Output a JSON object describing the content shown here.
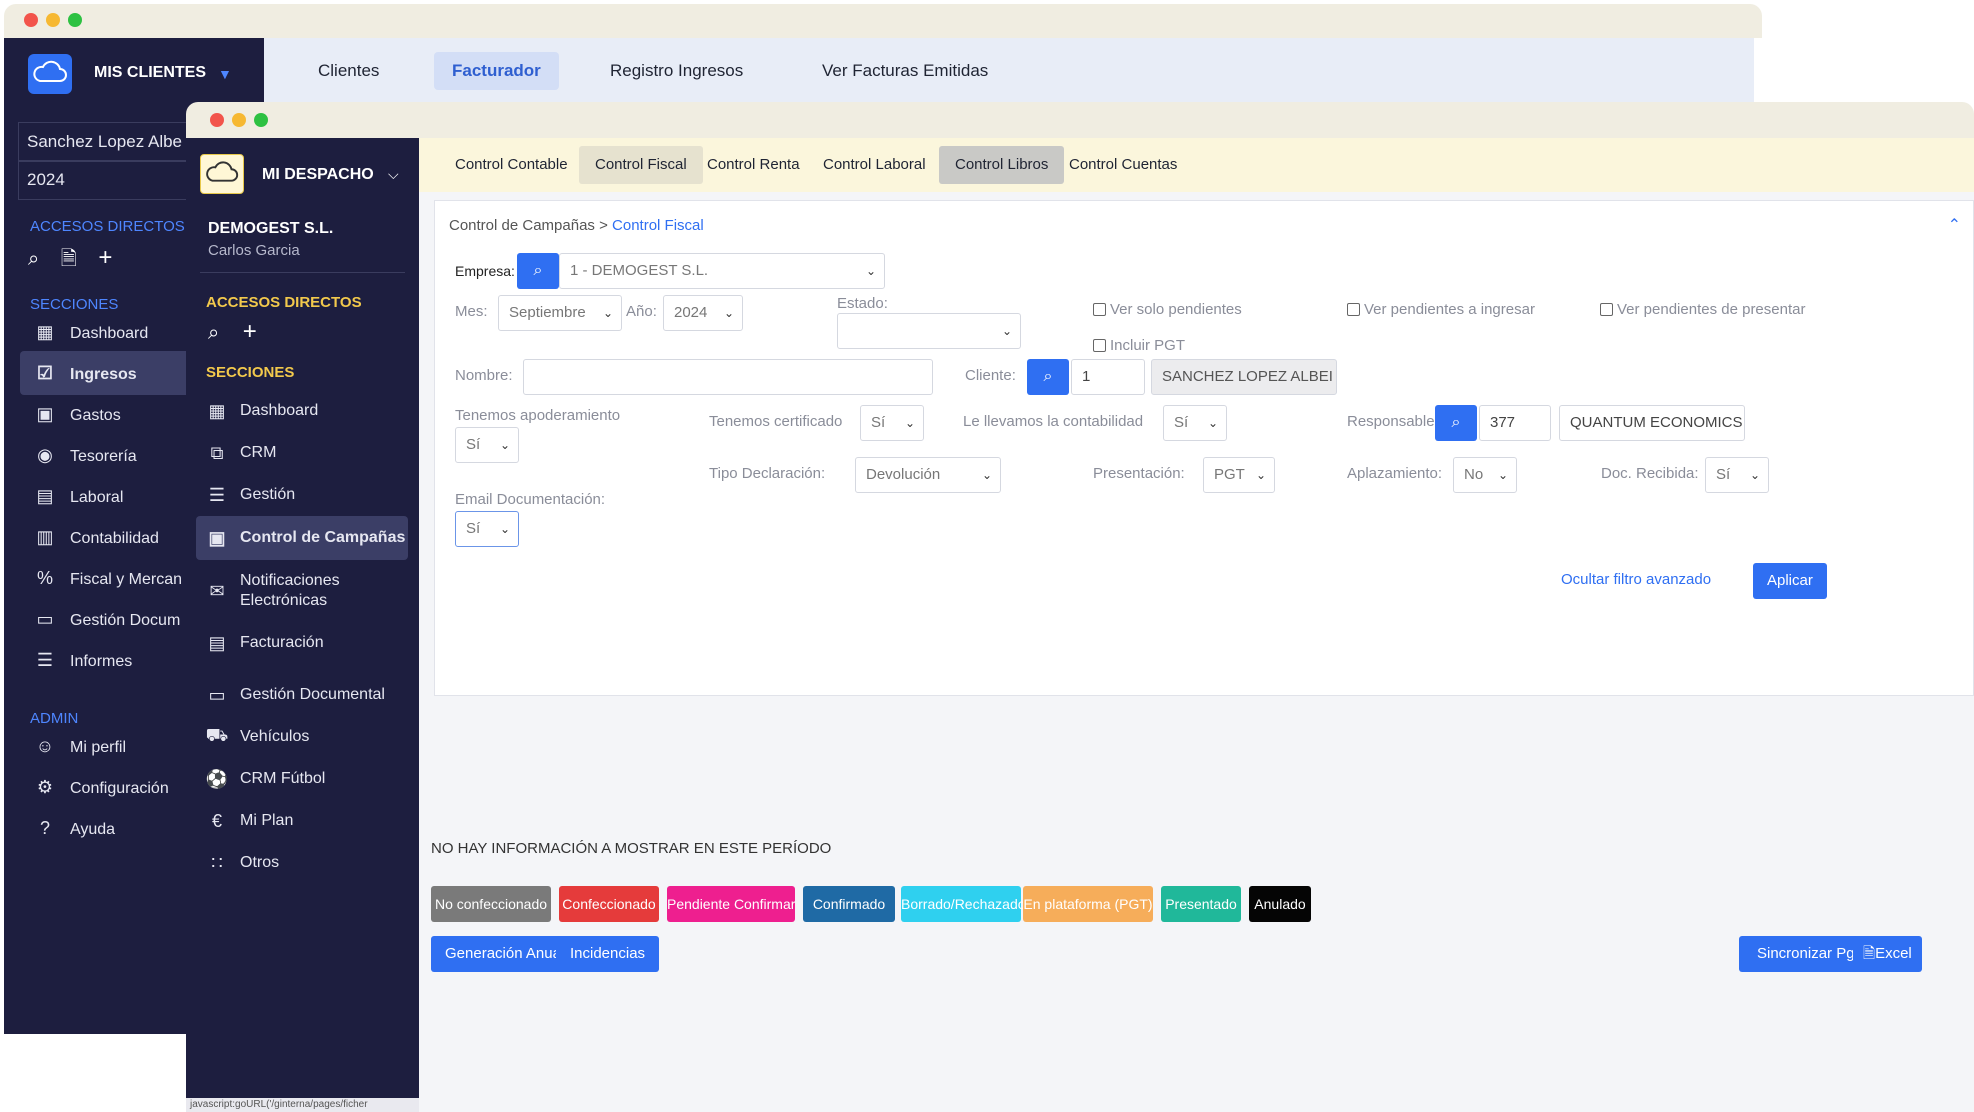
{
  "back_window": {
    "brand": "MIS CLIENTES",
    "client_field": "Sanchez Lopez Albe",
    "year_field": "2024",
    "quick_access_label": "ACCESOS DIRECTOS",
    "sections_label": "SECCIONES",
    "admin_label": "ADMIN",
    "nav": [
      "Clientes",
      "Facturador",
      "Registro Ingresos",
      "Ver Facturas Emitidas"
    ],
    "active_nav": "Facturador",
    "sidebar_items": [
      {
        "label": "Dashboard",
        "icon": "dashboard-icon"
      },
      {
        "label": "Ingresos",
        "icon": "ingresos-icon"
      },
      {
        "label": "Gastos",
        "icon": "gastos-icon"
      },
      {
        "label": "Tesorería",
        "icon": "tesoreria-icon"
      },
      {
        "label": "Laboral",
        "icon": "laboral-icon"
      },
      {
        "label": "Contabilidad",
        "icon": "contabilidad-icon"
      },
      {
        "label": "Fiscal y Mercan",
        "icon": "percent-icon"
      },
      {
        "label": "Gestión Docum",
        "icon": "folder-icon"
      },
      {
        "label": "Informes",
        "icon": "informes-icon"
      }
    ],
    "admin_items": [
      {
        "label": "Mi perfil",
        "icon": "user-icon"
      },
      {
        "label": "Configuración",
        "icon": "gear-icon"
      },
      {
        "label": "Ayuda",
        "icon": "help-icon"
      }
    ]
  },
  "front_window": {
    "brand": "MI DESPACHO",
    "company": "DEMOGEST S.L.",
    "user": "Carlos Garcia",
    "quick_access_label": "ACCESOS DIRECTOS",
    "sections_label": "SECCIONES",
    "sidebar_items": [
      {
        "label": "Dashboard",
        "icon": "dashboard-icon"
      },
      {
        "label": "CRM",
        "icon": "crm-icon"
      },
      {
        "label": "Gestión",
        "icon": "gestion-icon"
      },
      {
        "label": "Control de Campañas",
        "icon": "campaigns-icon"
      },
      {
        "label": "Notificaciones Electrónicas",
        "icon": "notifications-icon"
      },
      {
        "label": "Facturación",
        "icon": "invoice-icon"
      },
      {
        "label": "Gestión Documental",
        "icon": "folder-icon"
      },
      {
        "label": "Vehículos",
        "icon": "car-icon"
      },
      {
        "label": "CRM Fútbol",
        "icon": "football-icon"
      },
      {
        "label": "Mi Plan",
        "icon": "euro-icon"
      },
      {
        "label": "Otros",
        "icon": "grid-icon"
      }
    ],
    "status_bar": "javascript:goURL('/ginterna/pages/ficher",
    "tabs": [
      "Control Contable",
      "Control Fiscal",
      "Control Renta",
      "Control Laboral",
      "Control Libros",
      "Control Cuentas"
    ],
    "breadcrumb": {
      "parent": "Control de Campañas",
      "sep": ">",
      "current": "Control Fiscal"
    },
    "filters": {
      "empresa_label": "Empresa:",
      "empresa_value": "1 - DEMOGEST S.L.",
      "mes_label": "Mes:",
      "mes_value": "Septiembre",
      "anio_label": "Año:",
      "anio_value": "2024",
      "estado_label": "Estado:",
      "estado_value": "",
      "ver_solo_pendientes": "Ver solo pendientes",
      "incluir_pgt": "Incluir PGT",
      "ver_pendientes_ingresar": "Ver pendientes a ingresar",
      "ver_pendientes_presentar": "Ver pendientes de presentar",
      "nombre_label": "Nombre:",
      "nombre_value": "",
      "cliente_label": "Cliente:",
      "cliente_code": "1",
      "cliente_name": "SANCHEZ LOPEZ ALBEI",
      "apoderamiento_label": "Tenemos apoderamiento",
      "apoderamiento_value": "Sí",
      "certificado_label": "Tenemos certificado",
      "certificado_value": "Sí",
      "contabilidad_label": "Le llevamos la contabilidad",
      "contabilidad_value": "Sí",
      "responsable_label": "Responsable:",
      "responsable_code": "377",
      "responsable_name": "QUANTUM ECONOMICS",
      "tipo_decl_label": "Tipo Declaración:",
      "tipo_decl_value": "Devolución",
      "presentacion_label": "Presentación:",
      "presentacion_value": "PGT",
      "aplazamiento_label": "Aplazamiento:",
      "aplazamiento_value": "No",
      "doc_recibida_label": "Doc. Recibida:",
      "doc_recibida_value": "Sí",
      "email_doc_label": "Email Documentación:",
      "email_doc_value": "Sí",
      "hide_filter_link": "Ocultar filtro avanzado",
      "apply_button": "Aplicar"
    },
    "no_info": "NO HAY INFORMACIÓN A MOSTRAR EN ESTE PERÍODO",
    "status_legend": [
      {
        "label": "No confeccionado",
        "color": "#7a7a7a"
      },
      {
        "label": "Confeccionado",
        "color": "#e53b3b"
      },
      {
        "label": "Pendiente Confirmar",
        "color": "#ee1f8f"
      },
      {
        "label": "Confirmado",
        "color": "#1f6aa5"
      },
      {
        "label": "Borrado/Rechazado",
        "color": "#2fd0ef"
      },
      {
        "label": "En plataforma (PGT)",
        "color": "#f6ad5a"
      },
      {
        "label": "Presentado",
        "color": "#20b89a"
      },
      {
        "label": "Anulado",
        "color": "#050505"
      }
    ],
    "action_buttons": {
      "generacion_anual": "Generación Anual",
      "incidencias": "Incidencias",
      "sincronizar": "Sincronizar Pgt",
      "excel": "Excel"
    }
  }
}
